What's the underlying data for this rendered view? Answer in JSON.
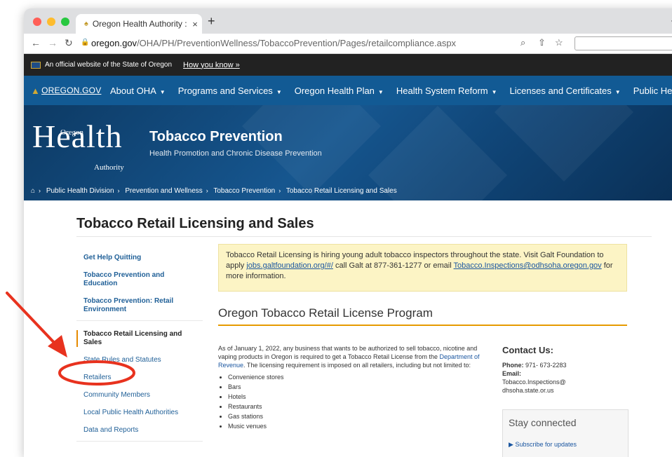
{
  "browser": {
    "tab_title": "Oregon Health Authority : Toba",
    "tab_close": "×",
    "new_tab": "+",
    "url_domain": "oregon.gov",
    "url_path": "/OHA/PH/PreventionWellness/TobaccoPrevention/Pages/retailcompliance.aspx",
    "colors": {
      "close": "#ff5f57",
      "minimize": "#febc2e",
      "maximize": "#28c840"
    }
  },
  "banner": {
    "official_text": "An official website of the State of Oregon",
    "how_link": "How you know »"
  },
  "mainnav": {
    "logo": "OREGON.GOV",
    "items": [
      {
        "label": "About OHA"
      },
      {
        "label": "Programs and Services"
      },
      {
        "label": "Oregon Health Plan"
      },
      {
        "label": "Health System Reform"
      },
      {
        "label": "Licenses and Certificates"
      },
      {
        "label": "Public Health"
      }
    ]
  },
  "hero": {
    "logo_big": "Health",
    "logo_oregon": "Oregon",
    "logo_authority": "Authority",
    "title": "Tobacco Prevention",
    "subtitle": "Health Promotion and Chronic Disease Prevention"
  },
  "breadcrumb": [
    "Public Health Division",
    "Prevention and Wellness",
    "Tobacco Prevention",
    "Tobacco Retail Licensing and Sales"
  ],
  "page": {
    "title": "Tobacco Retail Licensing and Sales"
  },
  "sidebar": {
    "items": [
      {
        "label": "Get Help Quitting"
      },
      {
        "label": "Tobacco Prevention and Education"
      },
      {
        "label": "Tobacco Prevention: Retail Environment"
      },
      {
        "label": "Tobacco Retail Licensing and Sales"
      },
      {
        "label": "State Rules and Statutes"
      },
      {
        "label": "Retailers"
      },
      {
        "label": "Community Members"
      },
      {
        "label": "Local Public Health Authorities"
      },
      {
        "label": "Data and Reports"
      }
    ]
  },
  "alert": {
    "text1": "Tobacco Retail Licensing is hiring young adult tobacco inspectors throughout the state. Visit Galt Foundation to apply ",
    "link1": "jobs.galtfoundation.org/#/",
    "text2": " call Galt at 877-361-1277 or email ",
    "link2": "Tobacco.Inspections@odhsoha.oregon.gov",
    "text3": " for more information."
  },
  "program": {
    "title": "Oregon Tobacco Retail License Program",
    "para1": "As of January 1, 2022, any business that wants to be authorized to sell tobacco, nicotine and vaping products in Oregon is required to get a Tobacco Retail License from the ",
    "para_link": "Department of Revenue",
    "para2": ". The licensing requirement is imposed on all retailers, including but not limited to:",
    "list": [
      "Convenience stores",
      "Bars",
      "Hotels",
      "Restaurants",
      "Gas stations",
      "Music venues"
    ]
  },
  "contact": {
    "heading": "Contact Us:",
    "phone_label": "Phone:",
    "phone": " 971- 673-2283",
    "email_label": "Email:",
    "email1": "Tobacco.Inspections@",
    "email2": "dhsoha.state.or.us"
  },
  "stay": {
    "title": "Stay connected",
    "subscribe": "Subscribe for updates"
  },
  "annotation": {
    "color": "#e8321e"
  }
}
